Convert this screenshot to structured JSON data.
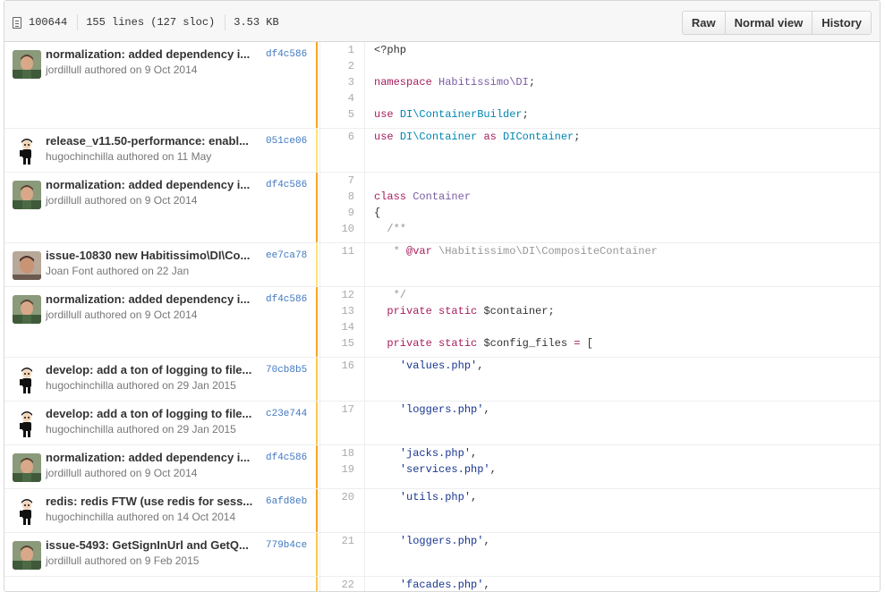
{
  "header": {
    "mode": "100644",
    "lines": "155 lines (127 sloc)",
    "size": "3.53 KB",
    "buttons": {
      "raw": "Raw",
      "normal": "Normal view",
      "history": "History"
    }
  },
  "hunks": [
    {
      "msg": "normalization: added dependency i...",
      "meta": "jordillull authored on 9 Oct 2014",
      "sha": "df4c586",
      "avatar": "jordi",
      "age_color": "#f5a623",
      "lines": [
        {
          "n": "1",
          "c": "<?php"
        },
        {
          "n": "2",
          "c": ""
        },
        {
          "n": "3",
          "c": "namespace Habitissimo\\DI;"
        },
        {
          "n": "4",
          "c": ""
        },
        {
          "n": "5",
          "c": "use DI\\ContainerBuilder;"
        }
      ]
    },
    {
      "msg": "release_v11.50-performance: enabl...",
      "meta": "hugochinchilla authored on 11 May",
      "sha": "051ce06",
      "avatar": "hugo",
      "age_color": "#ffe27a",
      "lines": [
        {
          "n": "6",
          "c": "use DI\\Container as DIContainer;"
        }
      ]
    },
    {
      "msg": "normalization: added dependency i...",
      "meta": "jordillull authored on 9 Oct 2014",
      "sha": "df4c586",
      "avatar": "jordi",
      "age_color": "#f5a623",
      "lines": [
        {
          "n": "7",
          "c": ""
        },
        {
          "n": "8",
          "c": "class Container"
        },
        {
          "n": "9",
          "c": "{"
        },
        {
          "n": "10",
          "c": "  /**"
        }
      ]
    },
    {
      "msg": "issue-10830 new Habitissimo\\DI\\Co...",
      "meta": "Joan Font authored on 22 Jan",
      "sha": "ee7ca78",
      "avatar": "joan",
      "age_color": "#ffe27a",
      "lines": [
        {
          "n": "11",
          "c": "   * @var \\Habitissimo\\DI\\CompositeContainer"
        }
      ]
    },
    {
      "msg": "normalization: added dependency i...",
      "meta": "jordillull authored on 9 Oct 2014",
      "sha": "df4c586",
      "avatar": "jordi",
      "age_color": "#f5a623",
      "lines": [
        {
          "n": "12",
          "c": "   */"
        },
        {
          "n": "13",
          "c": "  private static $container;"
        },
        {
          "n": "14",
          "c": ""
        },
        {
          "n": "15",
          "c": "  private static $config_files = ["
        }
      ]
    },
    {
      "msg": "develop: add a ton of logging to file...",
      "meta": "hugochinchilla authored on 29 Jan 2015",
      "sha": "70cb8b5",
      "avatar": "hugo",
      "age_color": "#f9c74f",
      "lines": [
        {
          "n": "16",
          "c": "    'values.php',"
        }
      ]
    },
    {
      "msg": "develop: add a ton of logging to file...",
      "meta": "hugochinchilla authored on 29 Jan 2015",
      "sha": "c23e744",
      "avatar": "hugo",
      "age_color": "#f9c74f",
      "lines": [
        {
          "n": "17",
          "c": "    'loggers.php',"
        }
      ]
    },
    {
      "msg": "normalization: added dependency i...",
      "meta": "jordillull authored on 9 Oct 2014",
      "sha": "df4c586",
      "avatar": "jordi",
      "age_color": "#f5a623",
      "lines": [
        {
          "n": "18",
          "c": "    'jacks.php',"
        },
        {
          "n": "19",
          "c": "    'services.php',"
        }
      ]
    },
    {
      "msg": "redis: redis FTW (use redis for sess...",
      "meta": "hugochinchilla authored on 14 Oct 2014",
      "sha": "6afd8eb",
      "avatar": "hugo",
      "age_color": "#f5a623",
      "lines": [
        {
          "n": "20",
          "c": "    'utils.php',"
        }
      ]
    },
    {
      "msg": "issue-5493: GetSignInUrl and GetQ...",
      "meta": "jordillull authored on 9 Feb 2015",
      "sha": "779b4ce",
      "avatar": "jordi",
      "age_color": "#f9c74f",
      "lines": [
        {
          "n": "21",
          "c": "    'loggers.php',"
        }
      ]
    },
    {
      "msg": "",
      "meta": "",
      "sha": "",
      "avatar": "",
      "age_color": "#f9c74f",
      "lines": [
        {
          "n": "22",
          "c": "    'facades.php',"
        }
      ]
    }
  ]
}
